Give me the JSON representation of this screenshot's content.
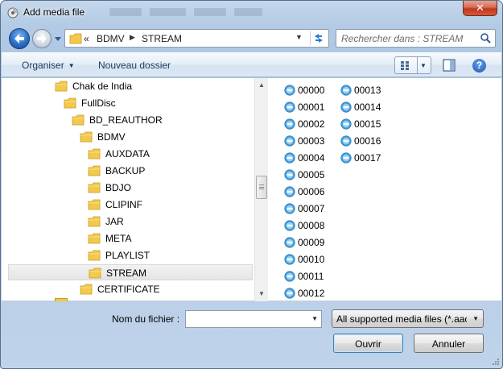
{
  "window": {
    "title": "Add media file",
    "close_label": "✕"
  },
  "address": {
    "overflow_chevron": "«",
    "crumbs": [
      "BDMV",
      "STREAM"
    ]
  },
  "search": {
    "placeholder": "Rechercher dans : STREAM"
  },
  "toolbar": {
    "organise_label": "Organiser",
    "new_folder_label": "Nouveau dossier",
    "help_label": "?"
  },
  "tree": {
    "items": [
      {
        "label": "Chak de India",
        "indent": 1
      },
      {
        "label": "FullDisc",
        "indent": 2
      },
      {
        "label": "BD_REAUTHOR",
        "indent": 3
      },
      {
        "label": "BDMV",
        "indent": 4
      },
      {
        "label": "AUXDATA",
        "indent": 5
      },
      {
        "label": "BACKUP",
        "indent": 5
      },
      {
        "label": "BDJO",
        "indent": 5
      },
      {
        "label": "CLIPINF",
        "indent": 5
      },
      {
        "label": "JAR",
        "indent": 5
      },
      {
        "label": "META",
        "indent": 5
      },
      {
        "label": "PLAYLIST",
        "indent": 5
      },
      {
        "label": "STREAM",
        "indent": 5,
        "selected": true
      },
      {
        "label": "CERTIFICATE",
        "indent": 4
      }
    ]
  },
  "files": {
    "column1": [
      "00000",
      "00001",
      "00002",
      "00003",
      "00004",
      "00005",
      "00006",
      "00007",
      "00008",
      "00009",
      "00010",
      "00011",
      "00012"
    ],
    "column2": [
      "00013",
      "00014",
      "00015",
      "00016",
      "00017"
    ],
    "icon": "media-file-icon"
  },
  "footer": {
    "filename_label": "Nom du fichier :",
    "filename_value": "",
    "filter_label": "All supported media files (*.aac",
    "open_label": "Ouvrir",
    "cancel_label": "Annuler"
  },
  "colors": {
    "accent": "#2a6fc5",
    "folder": "#f2c94c",
    "selection": "#e5e5e5",
    "file_icon": "#4aa3df"
  }
}
